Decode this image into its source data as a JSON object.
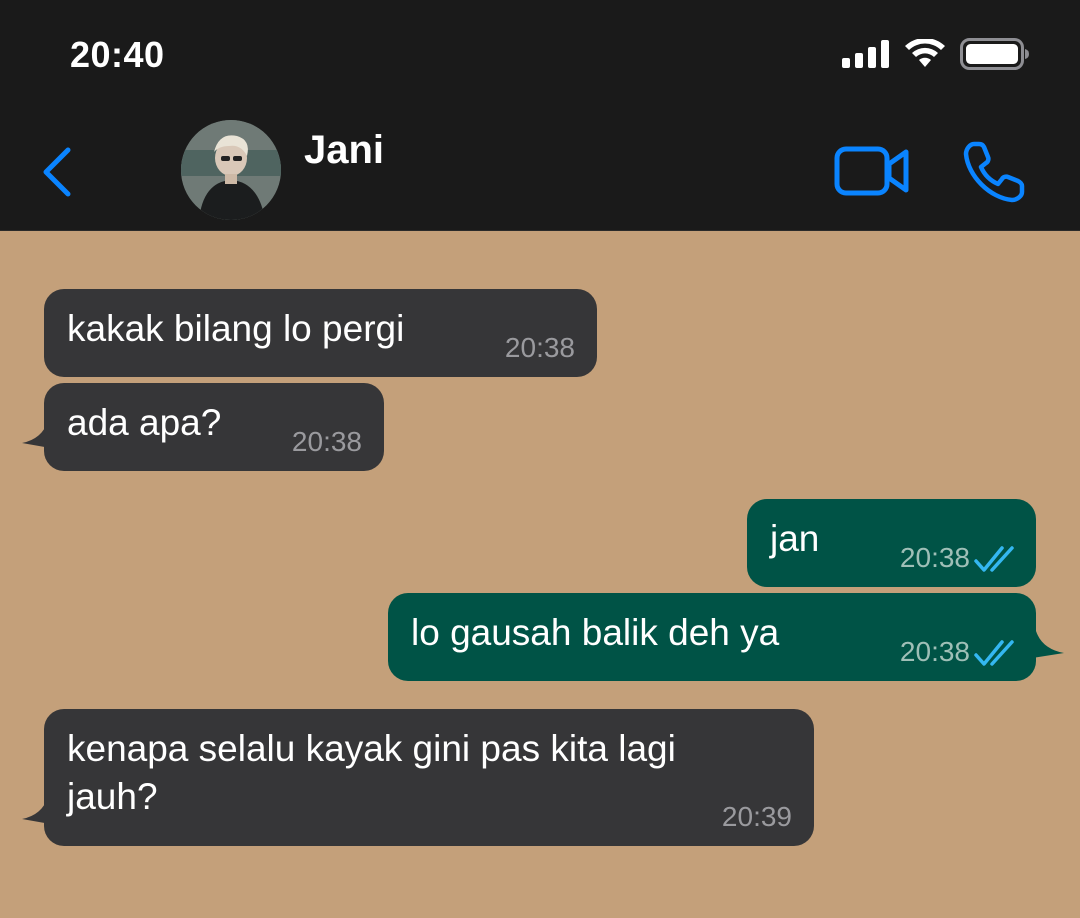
{
  "status_bar": {
    "time": "20:40",
    "icons": [
      "signal-icon",
      "wifi-icon",
      "battery-icon"
    ]
  },
  "header": {
    "contact_name": "Jani",
    "back_icon": "chevron-left-icon",
    "video_icon": "video-call-icon",
    "phone_icon": "phone-icon",
    "accent_color": "#0a84ff"
  },
  "messages": [
    {
      "direction": "incoming",
      "text": "kakak bilang lo pergi",
      "time": "20:38"
    },
    {
      "direction": "incoming",
      "text": "ada apa?",
      "time": "20:38"
    },
    {
      "direction": "outgoing",
      "text": "jan",
      "time": "20:38",
      "status": "read"
    },
    {
      "direction": "outgoing",
      "text": "lo gausah balik deh ya",
      "time": "20:38",
      "status": "read"
    },
    {
      "direction": "incoming",
      "text": "kenapa selalu kayak gini pas kita lagi jauh?",
      "time": "20:39"
    }
  ],
  "colors": {
    "wallpaper": "#c4a07a",
    "incoming_bubble": "#363638",
    "outgoing_bubble": "#005346",
    "read_ticks": "#34b7f1",
    "bar_background": "#1a1a1a"
  }
}
